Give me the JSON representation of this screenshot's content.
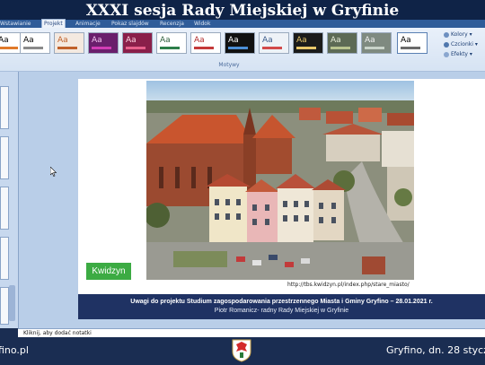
{
  "header": {
    "title": "XXXI sesja Rady Miejskiej w Gryfinie"
  },
  "ribbon": {
    "tabs": [
      "Wstawianie",
      "Projekt",
      "Animacje",
      "Pokaz slajdów",
      "Recenzja",
      "Widok"
    ],
    "active_tab": "Projekt",
    "group_label": "Motywy",
    "theme_sample": "Aa",
    "side_commands": [
      "Kolory",
      "Czcionki",
      "Efekty"
    ],
    "colors": {
      "ribbon_bg": "#dce7f5",
      "tab_strip": "#2f5c99"
    }
  },
  "slide": {
    "badge": "Kwidzyn",
    "photo_caption": "http://tbs.kwidzyn.pl/index.php/stare_miasto/",
    "banner_line1": "Uwagi do projektu Studium zagospodarowania  przestrzennego Miasta i Gminy Gryfino – 28.01.2021 r.",
    "banner_line2": "Piotr Romanicz- radny Rady Miejskiej w Gryfinie",
    "colors": {
      "banner": "#1f3263",
      "badge": "#3cab43"
    }
  },
  "notes": {
    "placeholder": "Kliknij, aby dodać notatki"
  },
  "footer": {
    "left_text": "fino.pl",
    "right_text": "Gryfino, dn. 28 stycz",
    "crest_icon": "city-crest-icon"
  }
}
